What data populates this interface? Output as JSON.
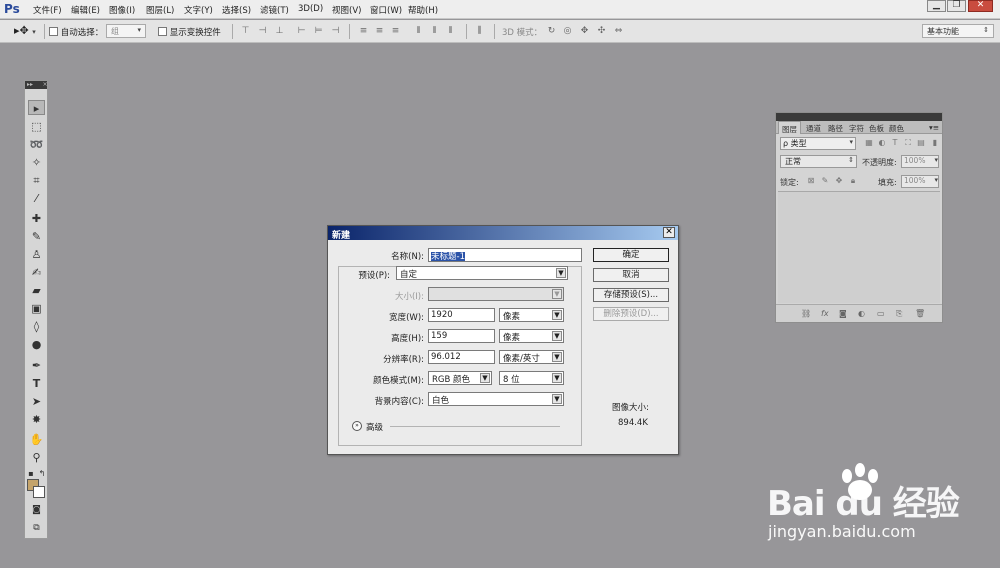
{
  "app": {
    "logo": "Ps"
  },
  "menu": [
    "文件(F)",
    "编辑(E)",
    "图像(I)",
    "图层(L)",
    "文字(Y)",
    "选择(S)",
    "滤镜(T)",
    "3D(D)",
    "视图(V)",
    "窗口(W)",
    "帮助(H)"
  ],
  "window_controls": {
    "minimize": "▁",
    "restore": "❐",
    "close": "✕"
  },
  "options_bar": {
    "auto_select_label": "自动选择：",
    "auto_select_value": "组",
    "show_transform_label": "显示变换控件",
    "mode_3d_label": "3D 模式：",
    "workspace": "基本功能"
  },
  "layers_panel": {
    "tabs": [
      "图层",
      "通道",
      "路径",
      "字符",
      "色板",
      "颜色"
    ],
    "filter": "ρ 类型",
    "blend_mode": "正常",
    "opacity_label": "不透明度:",
    "opacity_value": "100%",
    "lock_label": "锁定:",
    "fill_label": "填充:",
    "fill_value": "100%"
  },
  "dialog": {
    "title": "新建",
    "name_label": "名称(N):",
    "name_value": "未标题-1",
    "preset_label": "预设(P):",
    "preset_value": "自定",
    "size_label": "大小(I):",
    "width_label": "宽度(W):",
    "width_value": "1920",
    "width_unit": "像素",
    "height_label": "高度(H):",
    "height_value": "159",
    "height_unit": "像素",
    "resolution_label": "分辨率(R):",
    "resolution_value": "96.012",
    "resolution_unit": "像素/英寸",
    "color_mode_label": "颜色模式(M):",
    "color_mode_value": "RGB 颜色",
    "bit_depth": "8 位",
    "background_label": "背景内容(C):",
    "background_value": "白色",
    "advanced_label": "高级",
    "ok": "确定",
    "cancel": "取消",
    "save_preset": "存储预设(S)...",
    "delete_preset": "删除预设(D)...",
    "image_size_label": "图像大小:",
    "image_size_value": "894.4K"
  },
  "watermark": {
    "brand": "Bai du 经验",
    "url": "jingyan.baidu.com"
  },
  "colors": {
    "foreground": "#c5a46b",
    "background": "#ffffff",
    "workspace": "#979699"
  }
}
